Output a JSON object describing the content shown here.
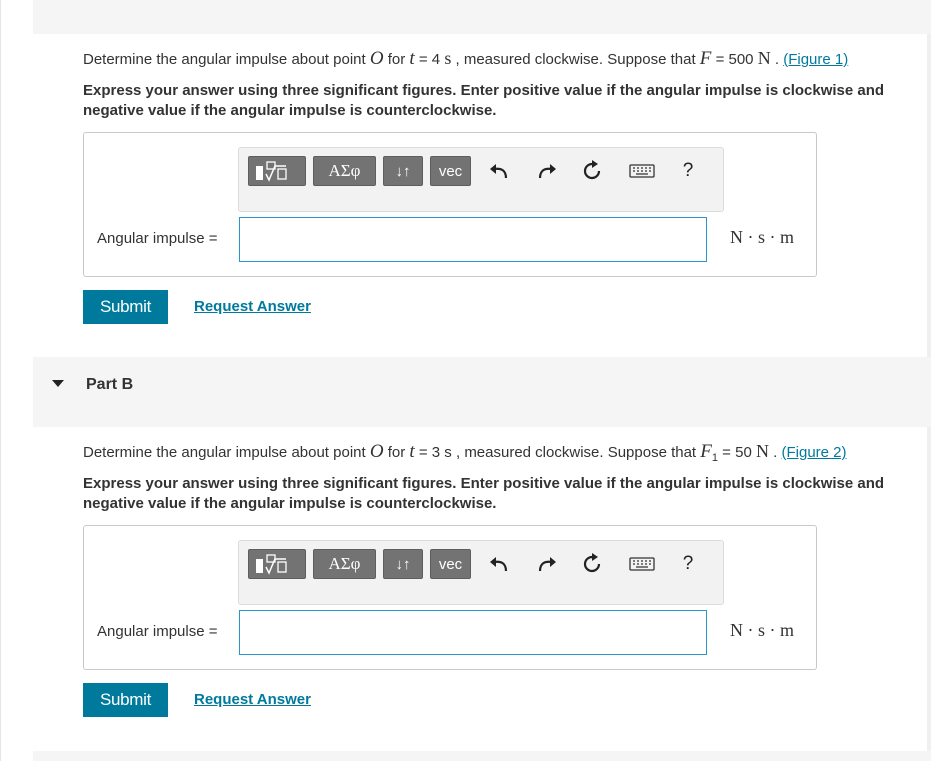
{
  "partA": {
    "question_prefix": "Determine the angular impulse about point ",
    "point": "O",
    "for_text": " for ",
    "t_var": "t",
    "t_eq": " = 4 ",
    "t_unit": "s",
    "middle": " , measured clockwise. Suppose that ",
    "force_var": "F",
    "force_eq": " = 500 ",
    "force_unit": "N",
    "dot": " . ",
    "figure_link": "(Figure 1)",
    "instruction": "Express your answer using three significant figures. Enter positive value if the angular impulse is clockwise and negative value if the angular impulse is counterclockwise.",
    "input_label": "Angular impulse =",
    "input_value": "",
    "unit": "N · s · m",
    "submit": "Submit",
    "request": "Request Answer"
  },
  "partB": {
    "title": "Part B",
    "question_prefix": "Determine the angular impulse about point ",
    "point": "O",
    "for_text": " for ",
    "t_var": "t",
    "t_eq": " = 3 s",
    "middle": " , measured clockwise. Suppose that ",
    "force_var": "F",
    "force_sub": "1",
    "force_eq": " = 50 ",
    "force_unit": "N",
    "dot": " . ",
    "figure_link": "(Figure 2)",
    "instruction": "Express your answer using three significant figures. Enter positive value if the angular impulse is clockwise and negative value if the angular impulse is counterclockwise.",
    "input_label": "Angular impulse =",
    "input_value": "",
    "unit": "N · s · m",
    "submit": "Submit",
    "request": "Request Answer"
  },
  "toolbar": {
    "greek": "ΑΣφ",
    "arrows": "↓↑",
    "vec": "vec",
    "help": "?"
  },
  "icons": [
    "templates-icon",
    "greek-icon",
    "subscript-icon",
    "vector-icon",
    "undo-icon",
    "redo-icon",
    "reset-icon",
    "keyboard-icon",
    "help-icon"
  ],
  "colors": {
    "link": "#007a9c",
    "submit_bg": "#007a9c",
    "input_border": "#2a95c9",
    "toolbar_button": "#737373"
  }
}
